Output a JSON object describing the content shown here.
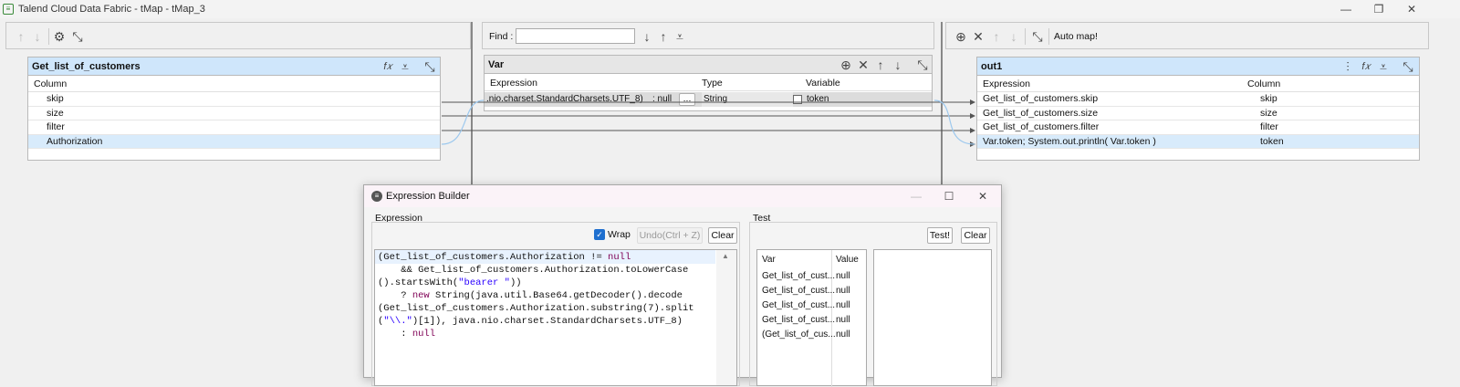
{
  "window": {
    "title": "Talend Cloud Data Fabric - tMap - tMap_3"
  },
  "left_panel": {
    "table_title": "Get_list_of_customers",
    "column_header": "Column",
    "rows": [
      "skip",
      "size",
      "filter",
      "Authorization"
    ]
  },
  "middle_panel": {
    "find_label": "Find :",
    "find_value": "",
    "var_title": "Var",
    "headers": {
      "expression": "Expression",
      "type": "Type",
      "variable": "Variable"
    },
    "row": {
      "expression": ".nio.charset.StandardCharsets.UTF_8)",
      "null_text": ": null",
      "more": "...",
      "type": "String",
      "variable": "token"
    }
  },
  "right_panel": {
    "auto_map": "Auto map!",
    "table_title": "out1",
    "headers": {
      "expression": "Expression",
      "column": "Column"
    },
    "rows": [
      {
        "expression": "Get_list_of_customers.skip",
        "column": "skip"
      },
      {
        "expression": "Get_list_of_customers.size",
        "column": "size"
      },
      {
        "expression": "Get_list_of_customers.filter",
        "column": "filter"
      },
      {
        "expression": "Var.token; System.out.println( Var.token )",
        "column": "token"
      }
    ]
  },
  "dialog": {
    "title": "Expression Builder",
    "expression_group": "Expression",
    "wrap_label": "Wrap",
    "undo_label": "Undo(Ctrl + Z)",
    "clear_label": "Clear",
    "test_group": "Test",
    "test_button": "Test!",
    "test_clear": "Clear",
    "code_lines": [
      "(Get_list_of_customers.Authorization != null",
      "    && Get_list_of_customers.Authorization.toLowerCase",
      "().startsWith(\"bearer \"))",
      "    ? new String(java.util.Base64.getDecoder().decode",
      "(Get_list_of_customers.Authorization.substring(7).split",
      "(\"\\\\.\")[1]), java.nio.charset.StandardCharsets.UTF_8)",
      "    : null"
    ],
    "test_headers": {
      "var": "Var",
      "value": "Value"
    },
    "test_rows": [
      {
        "var": "Get_list_of_cust...",
        "value": "null"
      },
      {
        "var": "Get_list_of_cust...",
        "value": "null"
      },
      {
        "var": "Get_list_of_cust...",
        "value": "null"
      },
      {
        "var": "Get_list_of_cust...",
        "value": "null"
      },
      {
        "var": "(Get_list_of_cus...",
        "value": "null"
      }
    ]
  }
}
